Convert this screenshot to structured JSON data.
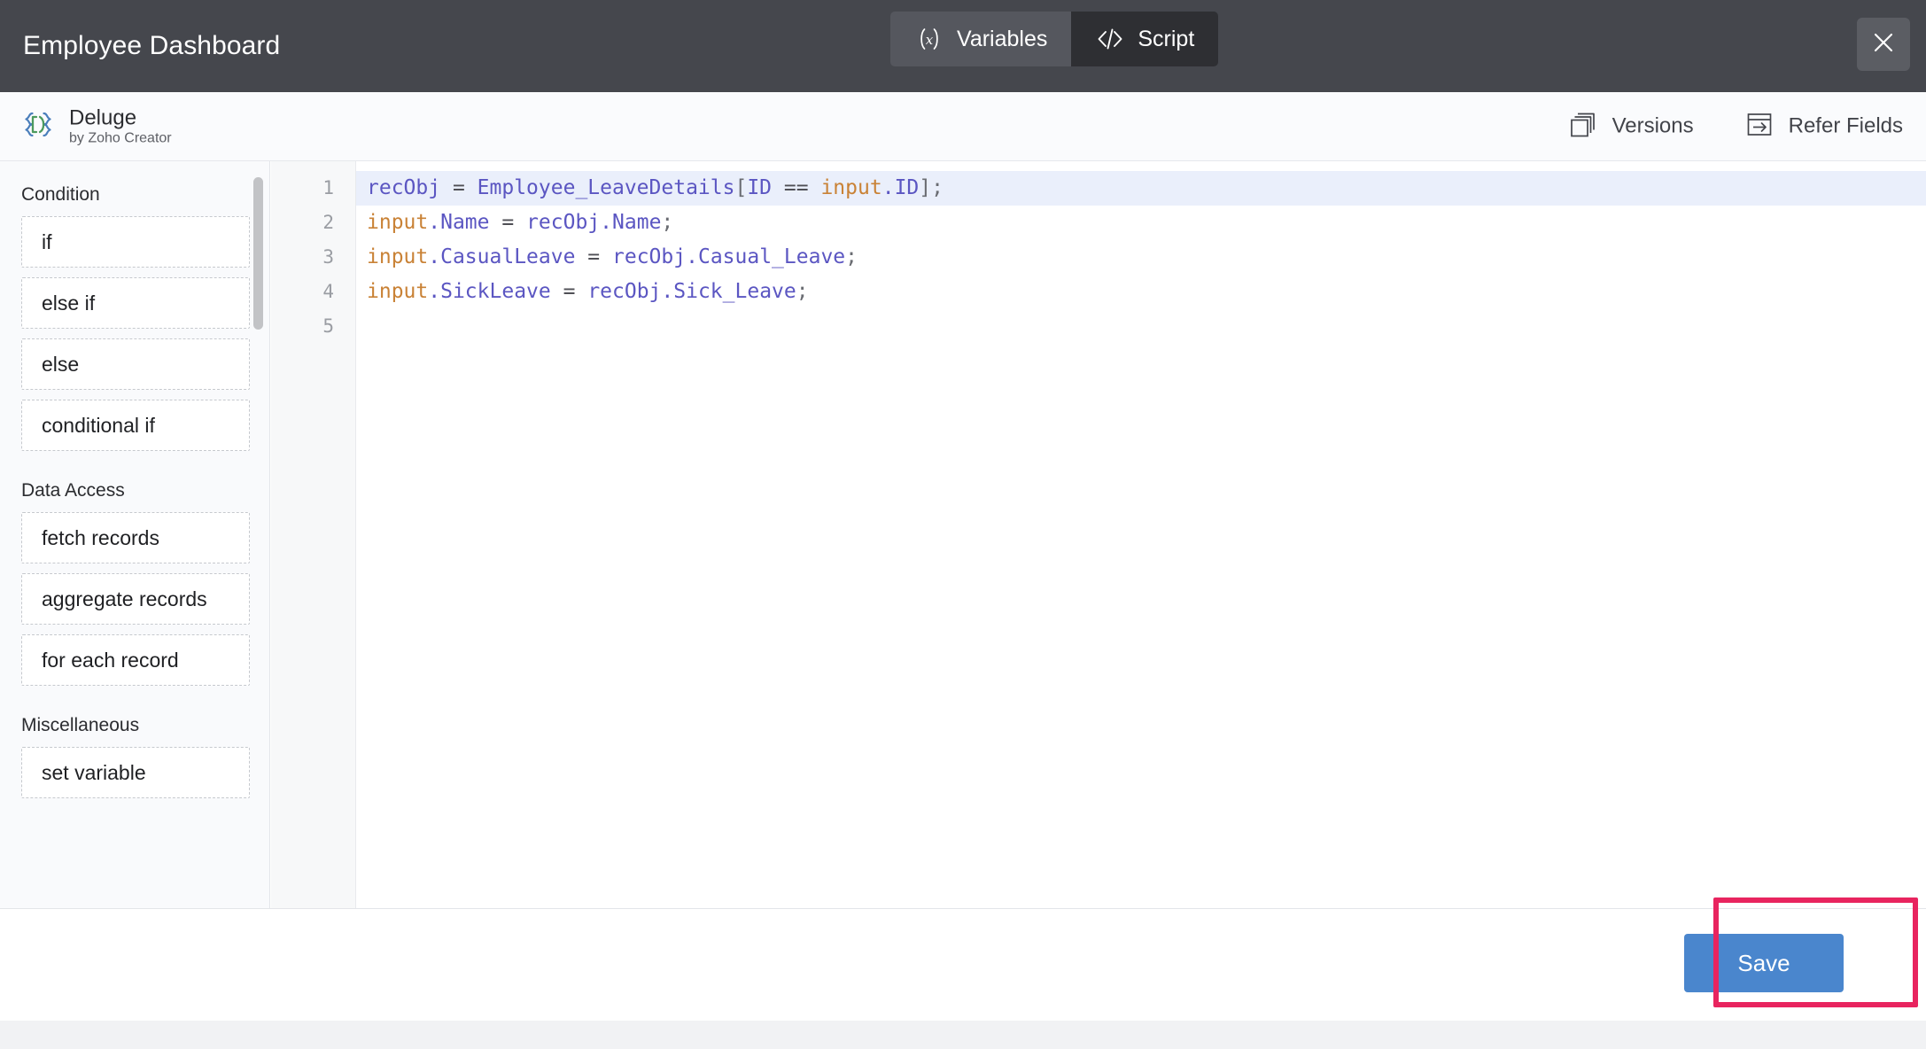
{
  "header": {
    "title": "Employee Dashboard",
    "tabs": [
      {
        "label": "Variables",
        "icon": "variables-paren-x-icon",
        "active": false
      },
      {
        "label": "Script",
        "icon": "code-angle-brackets-icon",
        "active": true
      }
    ],
    "close_icon": "close-icon"
  },
  "subbar": {
    "brand_name": "Deluge",
    "brand_sub": "by Zoho Creator",
    "brand_icon": "deluge-logo-icon",
    "actions": [
      {
        "label": "Versions",
        "icon": "layers-stack-icon"
      },
      {
        "label": "Refer Fields",
        "icon": "window-arrow-icon"
      }
    ]
  },
  "snippets": {
    "groups": [
      {
        "title": "Condition",
        "items": [
          "if",
          "else if",
          "else",
          "conditional if"
        ]
      },
      {
        "title": "Data Access",
        "items": [
          "fetch records",
          "aggregate records",
          "for each record"
        ]
      },
      {
        "title": "Miscellaneous",
        "items": [
          "set variable"
        ]
      }
    ]
  },
  "editor": {
    "line_numbers": [
      "1",
      "2",
      "3",
      "4",
      "5"
    ],
    "active_line": 1,
    "lines": [
      "recObj = Employee_LeaveDetails[ID == input.ID];",
      "input.Name = recObj.Name;",
      "input.CasualLeave = recObj.Casual_Leave;",
      "input.SickLeave = recObj.Sick_Leave;",
      ""
    ]
  },
  "footer": {
    "save_label": "Save"
  },
  "colors": {
    "topbar_bg": "#45474d",
    "tab_active_bg": "#2e2f33",
    "tab_inactive_bg": "#55575e",
    "accent_blue": "#4a86cd",
    "highlight_pink": "#e8245f",
    "code_purple": "#5b56c2",
    "code_orange": "#c98236",
    "deluge_blue": "#4a7ebb",
    "deluge_green": "#4c9a5e"
  }
}
